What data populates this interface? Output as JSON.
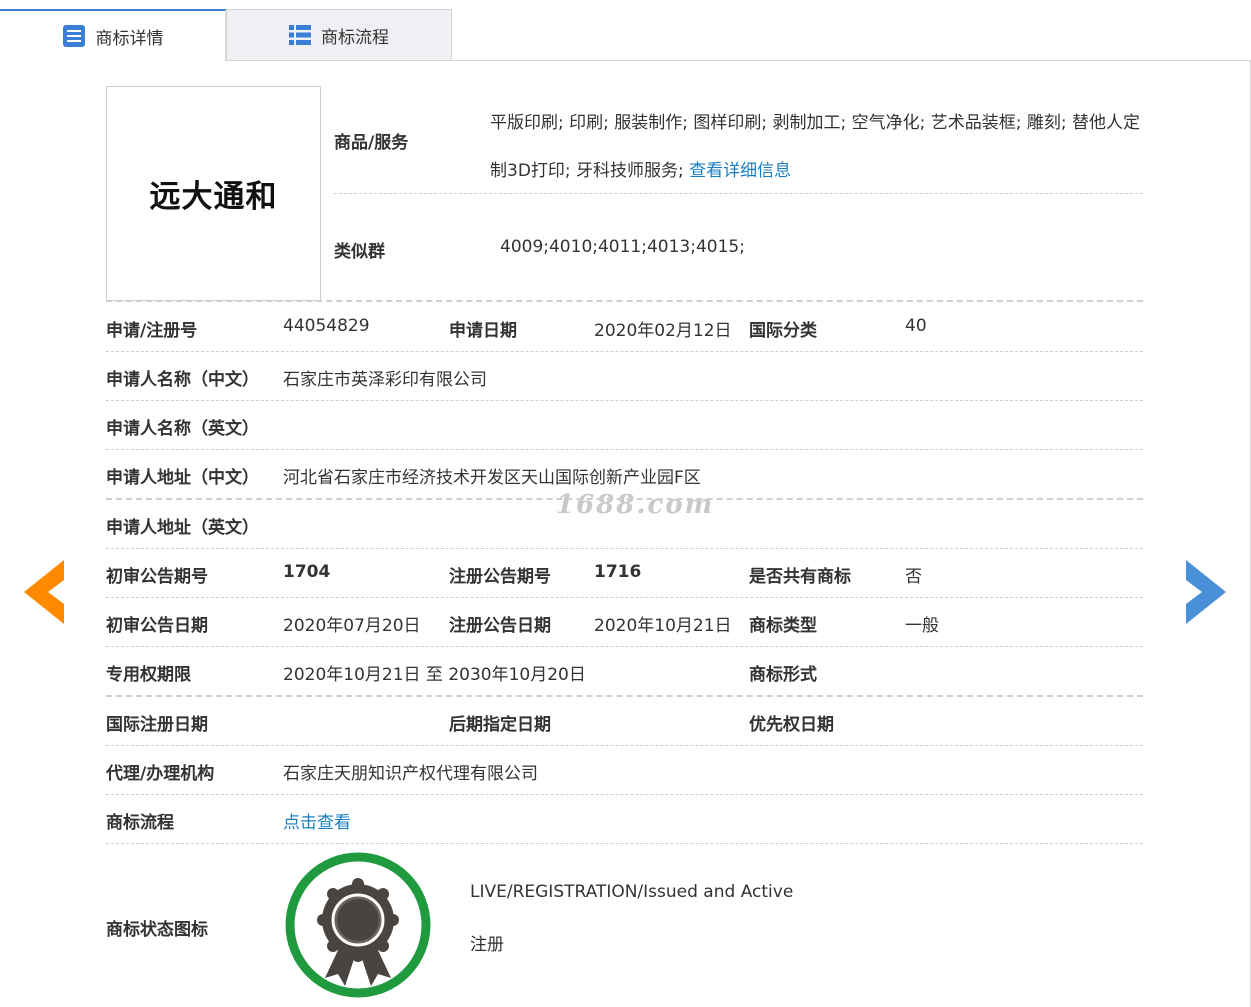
{
  "tabs": [
    {
      "label": "商标详情",
      "active": true,
      "icon": "document-list-icon"
    },
    {
      "label": "商标流程",
      "active": false,
      "icon": "list-icon"
    }
  ],
  "watermark": "1688.com",
  "logo_text": "远大通和",
  "goods": {
    "label": "商品/服务",
    "text": "平版印刷; 印刷; 服装制作; 图样印刷; 剥制加工; 空气净化; 艺术品装框; 雕刻; 替他人定制3D打印; 牙科技师服务; ",
    "link": "查看详细信息"
  },
  "similar": {
    "label": "类似群",
    "value": "4009;4010;4011;4013;4015;"
  },
  "rows": {
    "reg_no_label": "申请/注册号",
    "reg_no": "44054829",
    "apply_date_label": "申请日期",
    "apply_date": "2020年02月12日",
    "intl_class_label": "国际分类",
    "intl_class": "40",
    "applicant_cn_label": "申请人名称（中文）",
    "applicant_cn": "石家庄市英泽彩印有限公司",
    "applicant_en_label": "申请人名称（英文）",
    "applicant_en": "",
    "address_cn_label": "申请人地址（中文）",
    "address_cn": "河北省石家庄市经济技术开发区天山国际创新产业园F区",
    "address_en_label": "申请人地址（英文）",
    "address_en": "",
    "prelim_no_label": "初审公告期号",
    "prelim_no": "1704",
    "reg_pub_no_label": "注册公告期号",
    "reg_pub_no": "1716",
    "shared_label": "是否共有商标",
    "shared": "否",
    "prelim_date_label": "初审公告日期",
    "prelim_date": "2020年07月20日",
    "reg_pub_date_label": "注册公告日期",
    "reg_pub_date": "2020年10月21日",
    "tm_type_label": "商标类型",
    "tm_type": "一般",
    "exclusive_label": "专用权期限",
    "exclusive": "2020年10月21日 至 2030年10月20日",
    "tm_form_label": "商标形式",
    "tm_form": "",
    "intl_reg_date_label": "国际注册日期",
    "intl_reg_date": "",
    "later_date_label": "后期指定日期",
    "later_date": "",
    "priority_label": "优先权日期",
    "priority": "",
    "agent_label": "代理/办理机构",
    "agent": "石家庄天朋知识产权代理有限公司",
    "flow_label": "商标流程",
    "flow_link": "点击查看",
    "status_icon_label": "商标状态图标",
    "status_en": "LIVE/REGISTRATION/Issued and Active",
    "status_cn": "注册"
  },
  "colors": {
    "accent": "#3a7fd5",
    "link": "#1a7fc1",
    "prev_arrow": "#ff8a00",
    "next_arrow": "#4a90d9",
    "seal_ring": "#1f9a3f"
  }
}
